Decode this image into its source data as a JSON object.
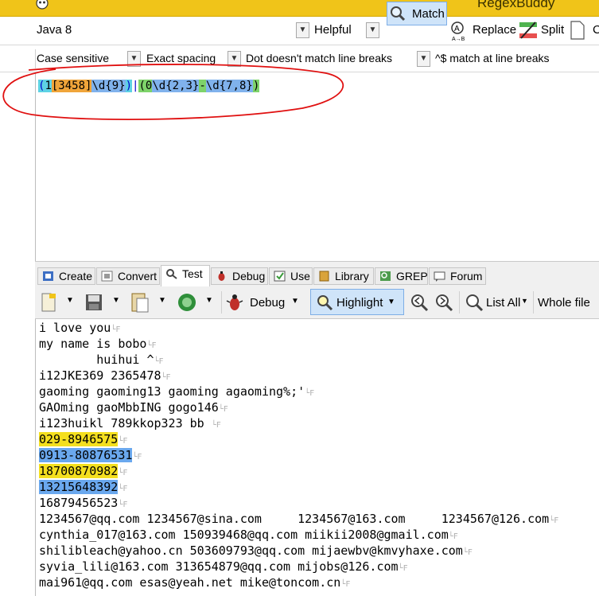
{
  "app": {
    "title": "RegexBuddy"
  },
  "toolbar": {
    "flavor": "Java 8",
    "helpful": "Helpful",
    "match": "Match",
    "replace": "Replace",
    "split": "Split",
    "copy_fragment": "C"
  },
  "options": {
    "case": "Case sensitive",
    "spacing": "Exact spacing",
    "dot": "Dot doesn't match line breaks",
    "anchors": "^$ match at line breaks"
  },
  "regex": {
    "parts": [
      "(",
      "1",
      "[3458]",
      "\\d{9}",
      ")",
      "|",
      "(",
      "0",
      "\\d{2,3}",
      "-",
      "\\d{7,8}",
      ")"
    ]
  },
  "tabs": [
    "Create",
    "Convert",
    "Test",
    "Debug",
    "Use",
    "Library",
    "GREP",
    "Forum"
  ],
  "test_toolbar": {
    "debug": "Debug",
    "highlight": "Highlight",
    "list_all": "List All",
    "whole_file": "Whole file"
  },
  "test_lines": [
    "i love you",
    "my name is bobo",
    "        huihui ^",
    "i12JKE369 2365478",
    "gaoming gaoming13 gaoming agaoming%;'",
    "GAOming gaoMbbING gogo146",
    "i123huikl 789kkop323 bb ",
    "029-8946575",
    "0913-80876531",
    "18700870982",
    "13215648392",
    "16879456523",
    "1234567@qq.com 1234567@sina.com     1234567@163.com     1234567@126.com",
    "cynthia_017@163.com 150939468@qq.com miikii2008@gmail.com",
    "shilibleach@yahoo.cn 503609793@qq.com mijaewbv@kmvyhaxe.com",
    "syvia_lili@163.com 313654879@qq.com mijobs@126.com",
    "mai961@qq.com esas@yeah.net mike@toncom.cn"
  ],
  "colors": {
    "title_bar": "#f0c419",
    "highlight_yellow": "#f4df1f",
    "highlight_blue": "#6aa8ee",
    "annotation": "#e01010"
  },
  "icons": [
    "app-logo-icon",
    "magnifier-icon",
    "replace-icon",
    "split-icon",
    "document-icon",
    "new-file-icon",
    "save-icon",
    "paste-icon",
    "refresh-icon",
    "bug-icon",
    "zoom-prev-icon",
    "zoom-next-icon",
    "list-all-icon"
  ]
}
